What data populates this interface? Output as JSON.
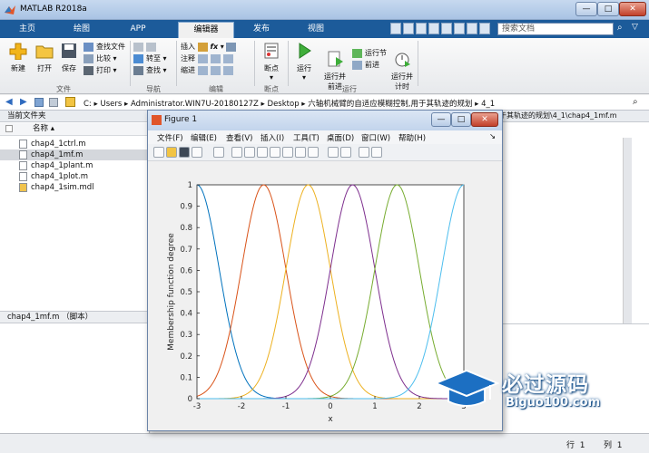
{
  "window": {
    "title": "MATLAB R2018a",
    "min": "—",
    "max": "□",
    "close": "✕"
  },
  "tabs": [
    {
      "label": "主页"
    },
    {
      "label": "绘图"
    },
    {
      "label": "APP"
    },
    {
      "label": "编辑器"
    },
    {
      "label": "发布"
    },
    {
      "label": "视图"
    }
  ],
  "search": {
    "placeholder": "搜索文档"
  },
  "ribbon": {
    "file": {
      "new": "新建",
      "open": "打开",
      "save": "保存",
      "find_files": "查找文件",
      "compare": "比较",
      "print": "打印",
      "group": "文件"
    },
    "nav": {
      "goto": "转至",
      "find": "查找",
      "group": "导航"
    },
    "edit": {
      "insert": "插入",
      "comment": "注释",
      "indent": "缩进",
      "group": "编辑"
    },
    "breakpoints": {
      "label": "断点",
      "group": "断点"
    },
    "run": {
      "run": "运行",
      "run_advance": "运行并\n前进",
      "run_section": "运行节",
      "advance": "前进",
      "run_time": "运行并\n计时",
      "group": "运行"
    }
  },
  "address": {
    "path": "C: ▸ Users ▸ Administrator.WIN7U-20180127Z ▸ Desktop ▸ 六轴机械臂的自适应模糊控制,用于其轨迹的规划 ▸ 4_1"
  },
  "left_panel": {
    "title": "当前文件夹",
    "column": "名称",
    "files": [
      {
        "name": "chap4_1ctrl.m"
      },
      {
        "name": "chap4_1mf.m"
      },
      {
        "name": "chap4_1plant.m"
      },
      {
        "name": "chap4_1plot.m"
      },
      {
        "name": "chap4_1sim.mdl"
      }
    ],
    "detail": "chap4_1mf.m （脚本）"
  },
  "editor": {
    "tab": "于其轨迹的规划\\4_1\\chap4_1mf.m"
  },
  "status": {
    "row_label": "行",
    "row": "1",
    "col_label": "列",
    "col": "1"
  },
  "figure": {
    "title": "Figure 1",
    "menu": [
      "文件(F)",
      "编辑(E)",
      "查看(V)",
      "插入(I)",
      "工具(T)",
      "桌面(D)",
      "窗口(W)",
      "帮助(H)"
    ]
  },
  "watermark": {
    "brand": "必过源码",
    "url": "Biguo100.com"
  },
  "chart_data": {
    "type": "line",
    "title": "",
    "xlabel": "x",
    "ylabel": "Membership function degree",
    "xlim": [
      -3,
      3
    ],
    "ylim": [
      0,
      1
    ],
    "xticks": [
      -3,
      -2,
      -1,
      0,
      1,
      2,
      3
    ],
    "yticks": [
      0,
      0.1,
      0.2,
      0.3,
      0.4,
      0.5,
      0.6,
      0.7,
      0.8,
      0.9,
      1
    ],
    "grid": false,
    "legend": "none",
    "curve_shape": "gaussian",
    "sigma": 0.5,
    "series": [
      {
        "center": -3,
        "color": "#0072BD"
      },
      {
        "center": -1.5,
        "color": "#D95319"
      },
      {
        "center": -0.5,
        "color": "#EDB120"
      },
      {
        "center": 0.5,
        "color": "#7E2F8E"
      },
      {
        "center": 1.5,
        "color": "#77AC30"
      },
      {
        "center": 3,
        "color": "#4DBEEE"
      }
    ]
  }
}
